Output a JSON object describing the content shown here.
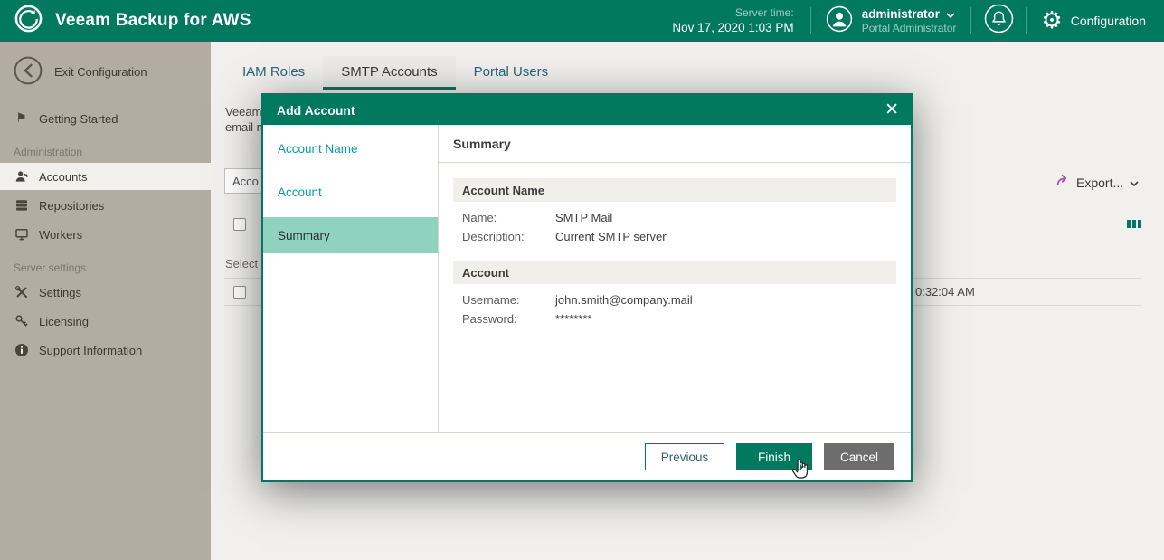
{
  "colors": {
    "accent_teal": "#00795f",
    "step_active_bg": "#8fd2be",
    "step_link_teal": "#0a9aa8",
    "sidebar_bg": "#b3aca2",
    "content_bg": "#f1f0ee",
    "export_icon_purple": "#a050a5",
    "cancel_gray": "#6d6d6d"
  },
  "icons": {
    "gear_glyph": "⚙",
    "flag_glyph": "⚑"
  },
  "header": {
    "app_title": "Veeam Backup for AWS",
    "server_time_label": "Server time:",
    "server_time_value": "Nov 17, 2020 1:03 PM",
    "user_name": "administrator",
    "user_role": "Portal Administrator",
    "configuration_label": "Configuration"
  },
  "sidebar": {
    "exit_label": "Exit Configuration",
    "section_administration": "Administration",
    "section_server_settings": "Server settings",
    "items": [
      {
        "label": "Getting Started"
      },
      {
        "label": "Accounts"
      },
      {
        "label": "Repositories"
      },
      {
        "label": "Workers"
      },
      {
        "label": "Settings"
      },
      {
        "label": "Licensing"
      },
      {
        "label": "Support Information"
      }
    ]
  },
  "tabs": [
    {
      "label": "IAM Roles"
    },
    {
      "label": "SMTP Accounts"
    },
    {
      "label": "Portal Users"
    }
  ],
  "main": {
    "desc_line1": "Veeam",
    "desc_line2": "email n",
    "filter_value": "Acco",
    "select_label": "Select",
    "row_time_partial": "0:32:04 AM",
    "export_label": "Export..."
  },
  "modal": {
    "title": "Add Account",
    "close_glyph": "✕",
    "steps": [
      {
        "label": "Account Name"
      },
      {
        "label": "Account"
      },
      {
        "label": "Summary"
      }
    ],
    "content_title": "Summary",
    "sections": [
      {
        "title": "Account Name",
        "rows": [
          {
            "label": "Name:",
            "value": "SMTP Mail"
          },
          {
            "label": "Description:",
            "value": "Current SMTP server"
          }
        ]
      },
      {
        "title": "Account",
        "rows": [
          {
            "label": "Username:",
            "value": "john.smith@company.mail"
          },
          {
            "label": "Password:",
            "value": "********"
          }
        ]
      }
    ],
    "buttons": {
      "previous": "Previous",
      "finish": "Finish",
      "cancel": "Cancel"
    }
  }
}
